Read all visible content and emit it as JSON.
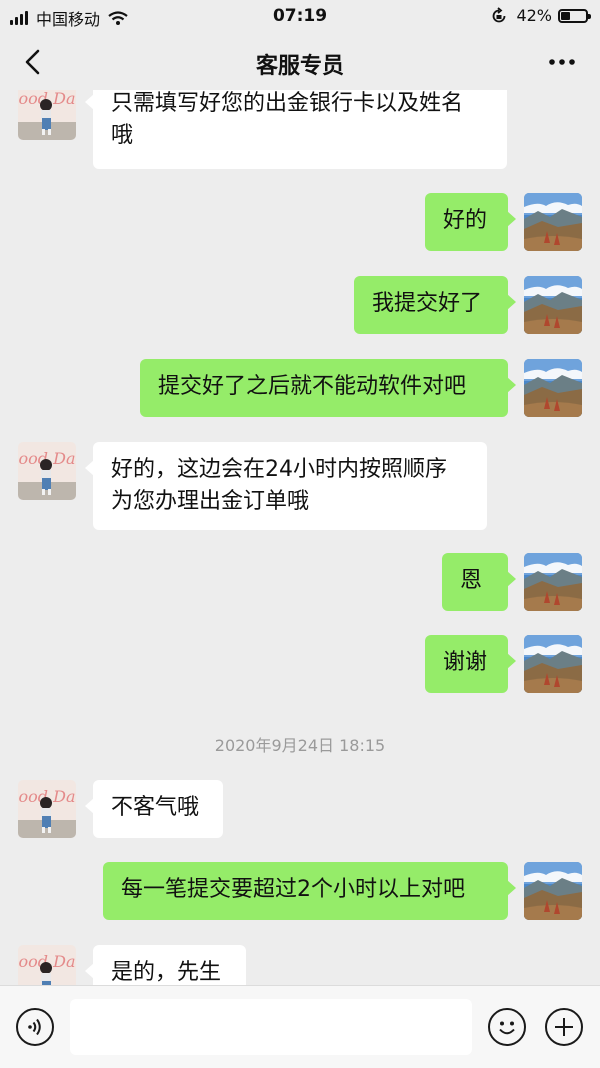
{
  "status_bar": {
    "carrier": "中国移动",
    "time": "07:19",
    "battery_text": "42%",
    "battery_level": 0.42
  },
  "header": {
    "title": "客服专员"
  },
  "timestamp": "2020年9月24日 18:15",
  "messages": [
    {
      "side": "left",
      "text": "只需填写好您的出金银行卡以及姓名\n哦"
    },
    {
      "side": "right",
      "text": "好的"
    },
    {
      "side": "right",
      "text": "我提交好了"
    },
    {
      "side": "right",
      "text": "提交好了之后就不能动软件对吧"
    },
    {
      "side": "left",
      "text": "好的，这边会在24小时内按照顺序\n为您办理出金订单哦"
    },
    {
      "side": "right",
      "text": "恩"
    },
    {
      "side": "right",
      "text": "谢谢"
    },
    {
      "side": "left",
      "text": "不客气哦"
    },
    {
      "side": "right",
      "text": "每一笔提交要超过2个小时以上对吧"
    },
    {
      "side": "left",
      "text": "是的，先生"
    }
  ],
  "input": {
    "value": ""
  },
  "colors": {
    "background": "#ededed",
    "sent_bubble": "#95ec69",
    "received_bubble": "#ffffff"
  }
}
